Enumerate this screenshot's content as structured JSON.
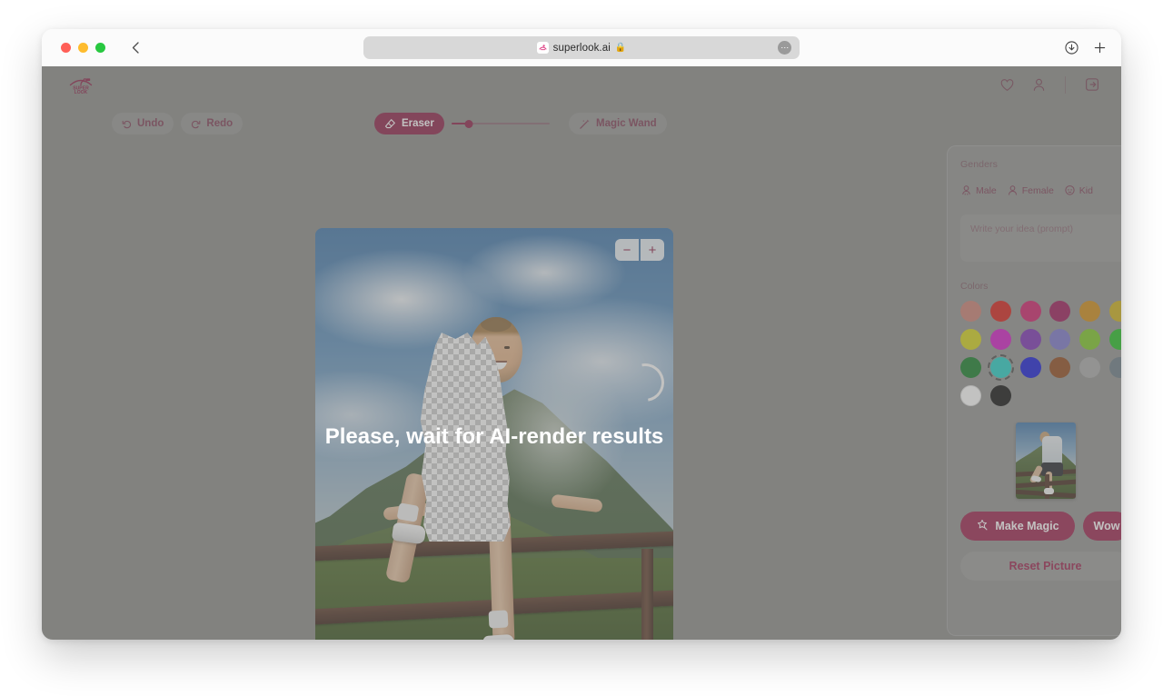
{
  "browser": {
    "url": "superlook.ai",
    "favicon_icon": "superlook-favicon-icon",
    "lock_icon": "lock-icon",
    "back_icon": "chevron-left-icon",
    "page_menu_icon": "ellipsis-icon",
    "download_icon": "download-icon",
    "new_tab_icon": "plus-icon"
  },
  "app": {
    "logo_text": "SUPER LOOK",
    "header_icons": [
      {
        "name": "favorites-icon",
        "glyph": "heart"
      },
      {
        "name": "account-icon",
        "glyph": "user"
      },
      {
        "name": "logout-icon",
        "glyph": "exit"
      }
    ]
  },
  "toolbar": {
    "undo_label": "Undo",
    "redo_label": "Redo",
    "eraser_label": "Eraser",
    "magic_wand_label": "Magic Wand",
    "brush_size_percent": 18
  },
  "canvas": {
    "zoom_out_label": "−",
    "zoom_in_label": "+",
    "loading_text": "Please, wait for AI-render results"
  },
  "panel": {
    "genders_label": "Genders",
    "genders": [
      {
        "label": "Male",
        "icon": "male-avatar-icon"
      },
      {
        "label": "Female",
        "icon": "female-avatar-icon"
      },
      {
        "label": "Kid",
        "icon": "kid-avatar-icon"
      }
    ],
    "prompt_placeholder": "Write your idea (prompt)",
    "prompt_value": "",
    "colors_label": "Colors",
    "colors": [
      {
        "hex": "#cc7f72",
        "selected": false
      },
      {
        "hex": "#d81c14",
        "selected": false
      },
      {
        "hex": "#cf1c69",
        "selected": false
      },
      {
        "hex": "#9c1457",
        "selected": false
      },
      {
        "hex": "#d28a11",
        "selected": false
      },
      {
        "hex": "#d0b115",
        "selected": false
      },
      {
        "hex": "#d6d317",
        "selected": false
      },
      {
        "hex": "#d318c6",
        "selected": false
      },
      {
        "hex": "#7a2fb5",
        "selected": false
      },
      {
        "hex": "#7b76cd",
        "selected": false
      },
      {
        "hex": "#7dc822",
        "selected": false
      },
      {
        "hex": "#1fc01f",
        "selected": false
      },
      {
        "hex": "#127c26",
        "selected": false
      },
      {
        "hex": "#22cfc7",
        "selected": true
      },
      {
        "hex": "#1318d8",
        "selected": false
      },
      {
        "hex": "#91481a",
        "selected": false
      },
      {
        "hex": "#a9a9a9",
        "selected": false
      },
      {
        "hex": "#6b7b85",
        "selected": false
      },
      {
        "hex": "#ffffff",
        "selected": false
      },
      {
        "hex": "#0d0d0d",
        "selected": false
      }
    ],
    "thumbnail_name": "original-photo-thumbnail",
    "make_magic_label": "Make Magic",
    "make_magic_icon": "magic-wand-icon",
    "wow_label": "Wow",
    "reset_label": "Reset Picture"
  },
  "theme": {
    "accent": "#9c1f4b",
    "accent_dark": "#8c1e46",
    "app_bg": "#8a8a88"
  }
}
